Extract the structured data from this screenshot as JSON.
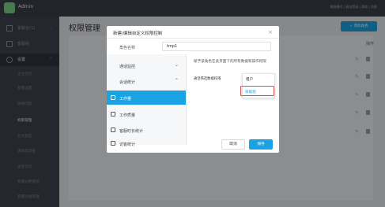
{
  "header": {
    "admin_name": "Admin",
    "right_links": "客服模式 | 退出登录 | 帮助 | 消息"
  },
  "sidebar": {
    "items": [
      {
        "label": "客服台(1)"
      },
      {
        "label": "客服组"
      },
      {
        "label": "设置"
      }
    ],
    "subitems": [
      {
        "label": "企业信息"
      },
      {
        "label": "客服设置"
      },
      {
        "label": "快捷回复"
      },
      {
        "label": "权限管理"
      },
      {
        "label": "业务类型"
      },
      {
        "label": "满意度调查"
      },
      {
        "label": "访客信息"
      },
      {
        "label": "客服分配规则"
      },
      {
        "label": "客服分组管理"
      }
    ]
  },
  "main": {
    "title": "权限管理",
    "add_button": "+ 添加角色",
    "ops_header": "操作"
  },
  "modal": {
    "title": "新建/编辑自定义权限控制",
    "role_label": "角色名称",
    "role_value": "tmp1",
    "tree": [
      {
        "label": "通话监控",
        "expanded": false
      },
      {
        "label": "会话统计",
        "expanded": true
      }
    ],
    "checks": [
      {
        "label": "工作量",
        "selected": true
      },
      {
        "label": "工作质量",
        "selected": false
      },
      {
        "label": "客服时长统计",
        "selected": false
      },
      {
        "label": "访客统计",
        "selected": false
      }
    ],
    "description": "赋予该角色在此页面下的所有数据和操作权限",
    "filter_label": "通话筛选数据权限",
    "dropdown_options": [
      {
        "label": "租户"
      },
      {
        "label": "技能组"
      }
    ],
    "cancel_label": "取消",
    "ok_label": "保存"
  },
  "colors": {
    "accent": "#1aa3e2",
    "highlight_border": "#d9534f"
  }
}
